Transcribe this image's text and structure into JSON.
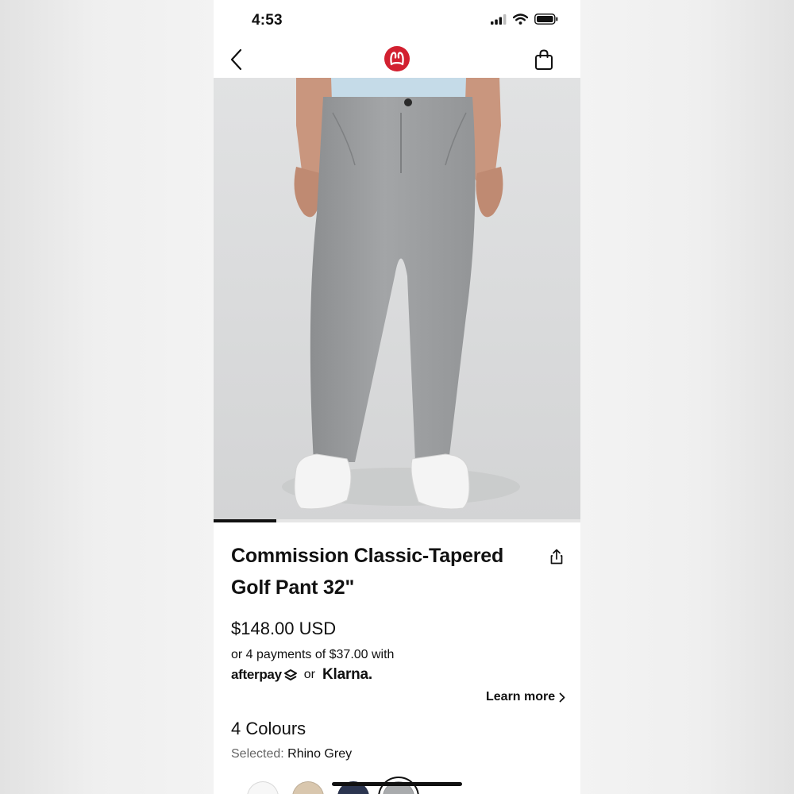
{
  "status_bar": {
    "time": "4:53"
  },
  "nav": {
    "back_icon": "chevron-left-icon",
    "logo_icon": "lululemon-logo",
    "bag_icon": "shopping-bag-icon"
  },
  "product": {
    "name": "Commission Classic-Tapered Golf Pant 32\"",
    "price": "$148.00 USD",
    "installments": "or 4 payments of $37.00 with",
    "afterpay_label": "afterpay",
    "or_label": "or",
    "klarna_label": "Klarna.",
    "learn_more": "Learn more",
    "colour_count": "4 Colours",
    "selected_label": "Selected:",
    "selected_colour": "Rhino Grey",
    "image_position": 1,
    "image_progress": 0.17
  },
  "swatches": [
    {
      "color": "#f7f7f7",
      "selected": false
    },
    {
      "color": "#d9c7ae",
      "selected": false
    },
    {
      "color": "#2b3550",
      "selected": false
    },
    {
      "color": "#a9abad",
      "selected": true
    }
  ],
  "colors": {
    "brand": "#d22030",
    "text": "#111111",
    "hero_bg": "#d8d9da",
    "pant": "#9a9c9e"
  }
}
